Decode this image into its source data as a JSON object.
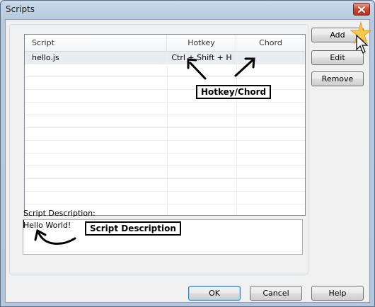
{
  "window": {
    "title": "Scripts"
  },
  "list": {
    "columns": [
      "Script",
      "Hotkey",
      "Chord"
    ],
    "rows": [
      {
        "script": "hello.js",
        "hotkey": "Ctrl + Shift + H",
        "chord": ""
      }
    ]
  },
  "side_buttons": {
    "add": "Add",
    "edit": "Edit",
    "remove": "Remove"
  },
  "description": {
    "label": "Script Description:",
    "value": "Hello World!"
  },
  "footer_buttons": {
    "ok": "OK",
    "cancel": "Cancel",
    "help": "Help"
  },
  "annotations": {
    "hotkey_chord": "Hotkey/Chord",
    "script_description": "Script Description"
  }
}
